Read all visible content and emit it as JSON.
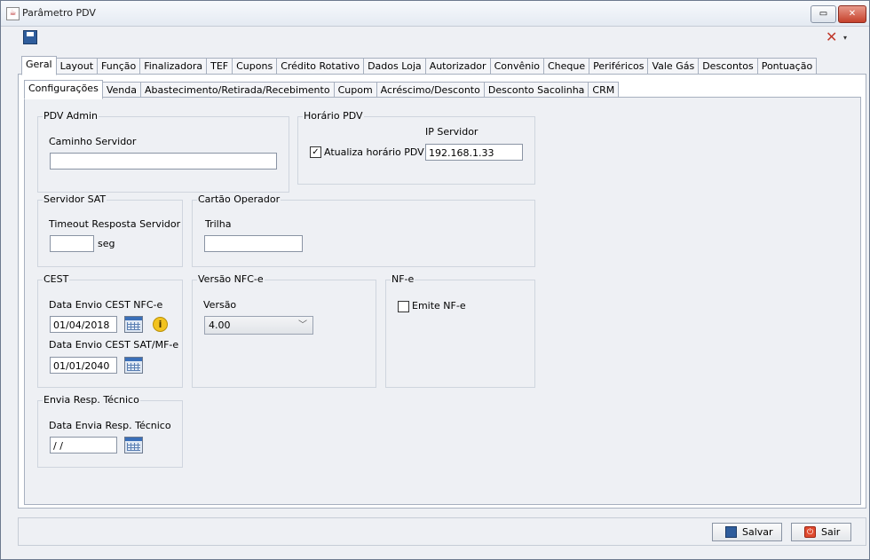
{
  "window": {
    "title": "Parâmetro PDV",
    "minimize_glyph": "▭",
    "close_glyph": "✕"
  },
  "toolbar": {
    "save_icon": "floppy-disk-icon",
    "tools_icon": "tools-icon",
    "tools_glyph": "✕",
    "caret_glyph": "▾"
  },
  "main_tabs": [
    "Geral",
    "Layout",
    "Função",
    "Finalizadora",
    "TEF",
    "Cupons",
    "Crédito Rotativo",
    "Dados Loja",
    "Autorizador",
    "Convênio",
    "Cheque",
    "Periféricos",
    "Vale Gás",
    "Descontos",
    "Pontuação"
  ],
  "sub_tabs": [
    "Configurações",
    "Venda",
    "Abastecimento/Retirada/Recebimento",
    "Cupom",
    "Acréscimo/Desconto",
    "Desconto Sacolinha",
    "CRM"
  ],
  "pdv_admin": {
    "legend": "PDV Admin",
    "caminho_label": "Caminho Servidor",
    "caminho_value": ""
  },
  "horario_pdv": {
    "legend": "Horário PDV",
    "atualiza_label": "Atualiza horário PDV",
    "atualiza_checked": true,
    "check_glyph": "✓",
    "ip_label": "IP Servidor",
    "ip_value": "192.168.1.33"
  },
  "servidor_sat": {
    "legend": "Servidor SAT",
    "timeout_label": "Timeout Resposta Servidor",
    "timeout_value": "",
    "unit": "seg"
  },
  "cartao_operador": {
    "legend": "Cartão Operador",
    "trilha_label": "Trilha",
    "trilha_value": ""
  },
  "cest": {
    "legend": "CEST",
    "nfce_label": "Data Envio CEST NFC-e",
    "nfce_value": "01/04/2018",
    "sat_label": "Data Envio CEST SAT/MF-e",
    "sat_value": "01/01/2040",
    "info_glyph": "i"
  },
  "versao_nfce": {
    "legend": "Versão NFC-e",
    "versao_label": "Versão",
    "versao_value": "4.00",
    "chev_glyph": "﹀"
  },
  "nfe": {
    "legend": "NF-e",
    "emite_label": "Emite NF-e",
    "emite_checked": false
  },
  "resp_tecnico": {
    "legend": "Envia Resp. Técnico",
    "data_label": "Data Envia Resp. Técnico",
    "data_value": " / /"
  },
  "footer": {
    "salvar_label": "Salvar",
    "sair_label": "Sair",
    "sair_glyph": "⏻"
  }
}
